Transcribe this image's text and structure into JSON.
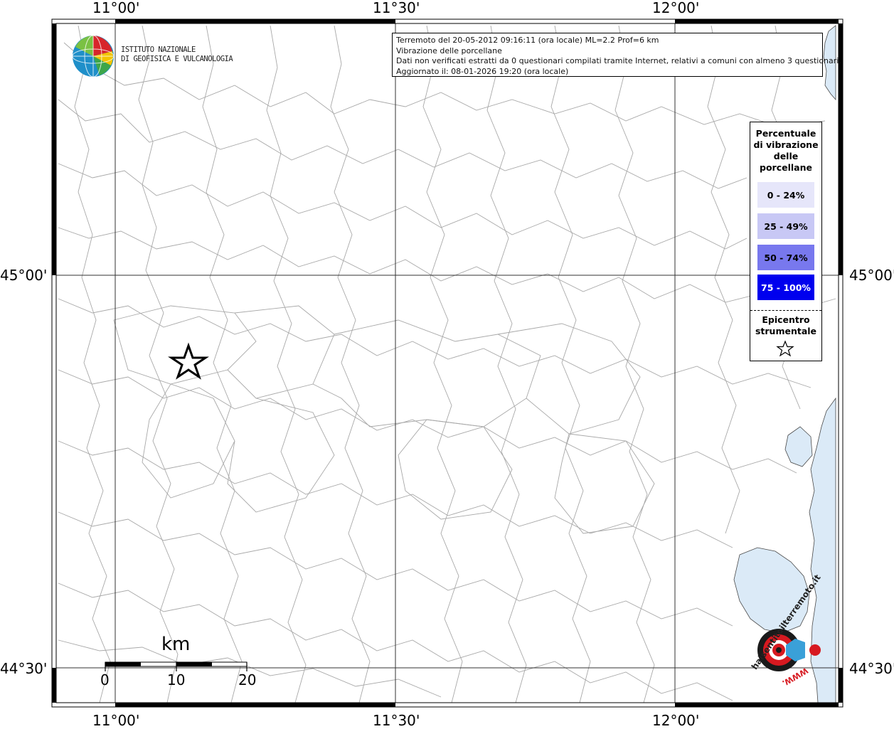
{
  "header": {
    "logo_line1": "ISTITUTO NAZIONALE",
    "logo_line2": "DI GEOFISICA E VULCANOLOGIA"
  },
  "info": {
    "line1": "Terremoto del 20-05-2012 09:16:11 (ora locale) ML=2.2 Prof=6 km",
    "line2": "Vibrazione delle porcellane",
    "line3": "Dati non verificati estratti da 0 questionari compilati tramite Internet, relativi a comuni con almeno 3 questionari.",
    "line4": "Aggiornato il: 08-01-2026 19:20 (ora locale)"
  },
  "axes": {
    "lon_top": [
      "11°00'",
      "11°30'",
      "12°00'"
    ],
    "lon_bottom": [
      "11°00'",
      "11°30'",
      "12°00'"
    ],
    "lat_left": [
      "45°00'",
      "44°30'"
    ],
    "lat_right": [
      "45°00'",
      "44°30'"
    ]
  },
  "legend": {
    "title_lines": [
      "Percentuale",
      "di vibrazione",
      "delle",
      "porcellane"
    ],
    "classes": [
      {
        "label": "0 - 24%",
        "color": "#e6e6fa",
        "text_color": "#000000"
      },
      {
        "label": "25 - 49%",
        "color": "#c8c8f5",
        "text_color": "#000000"
      },
      {
        "label": "50 - 74%",
        "color": "#7878ee",
        "text_color": "#000000"
      },
      {
        "label": "75 - 100%",
        "color": "#0000ee",
        "text_color": "#ffffff"
      }
    ],
    "epicenter_lines": [
      "Epicentro",
      "strumentale"
    ],
    "epicenter_symbol": "star-outline"
  },
  "scale": {
    "unit": "km",
    "ticks": [
      "0",
      "10",
      "20"
    ]
  },
  "watermark": {
    "text": "haisentitoilterremoto.it",
    "url_text": "WWW."
  },
  "colors": {
    "sea": "#dbeaf7",
    "boundary": "#a8a8a8",
    "grid": "#333333",
    "frame": "#000000"
  }
}
